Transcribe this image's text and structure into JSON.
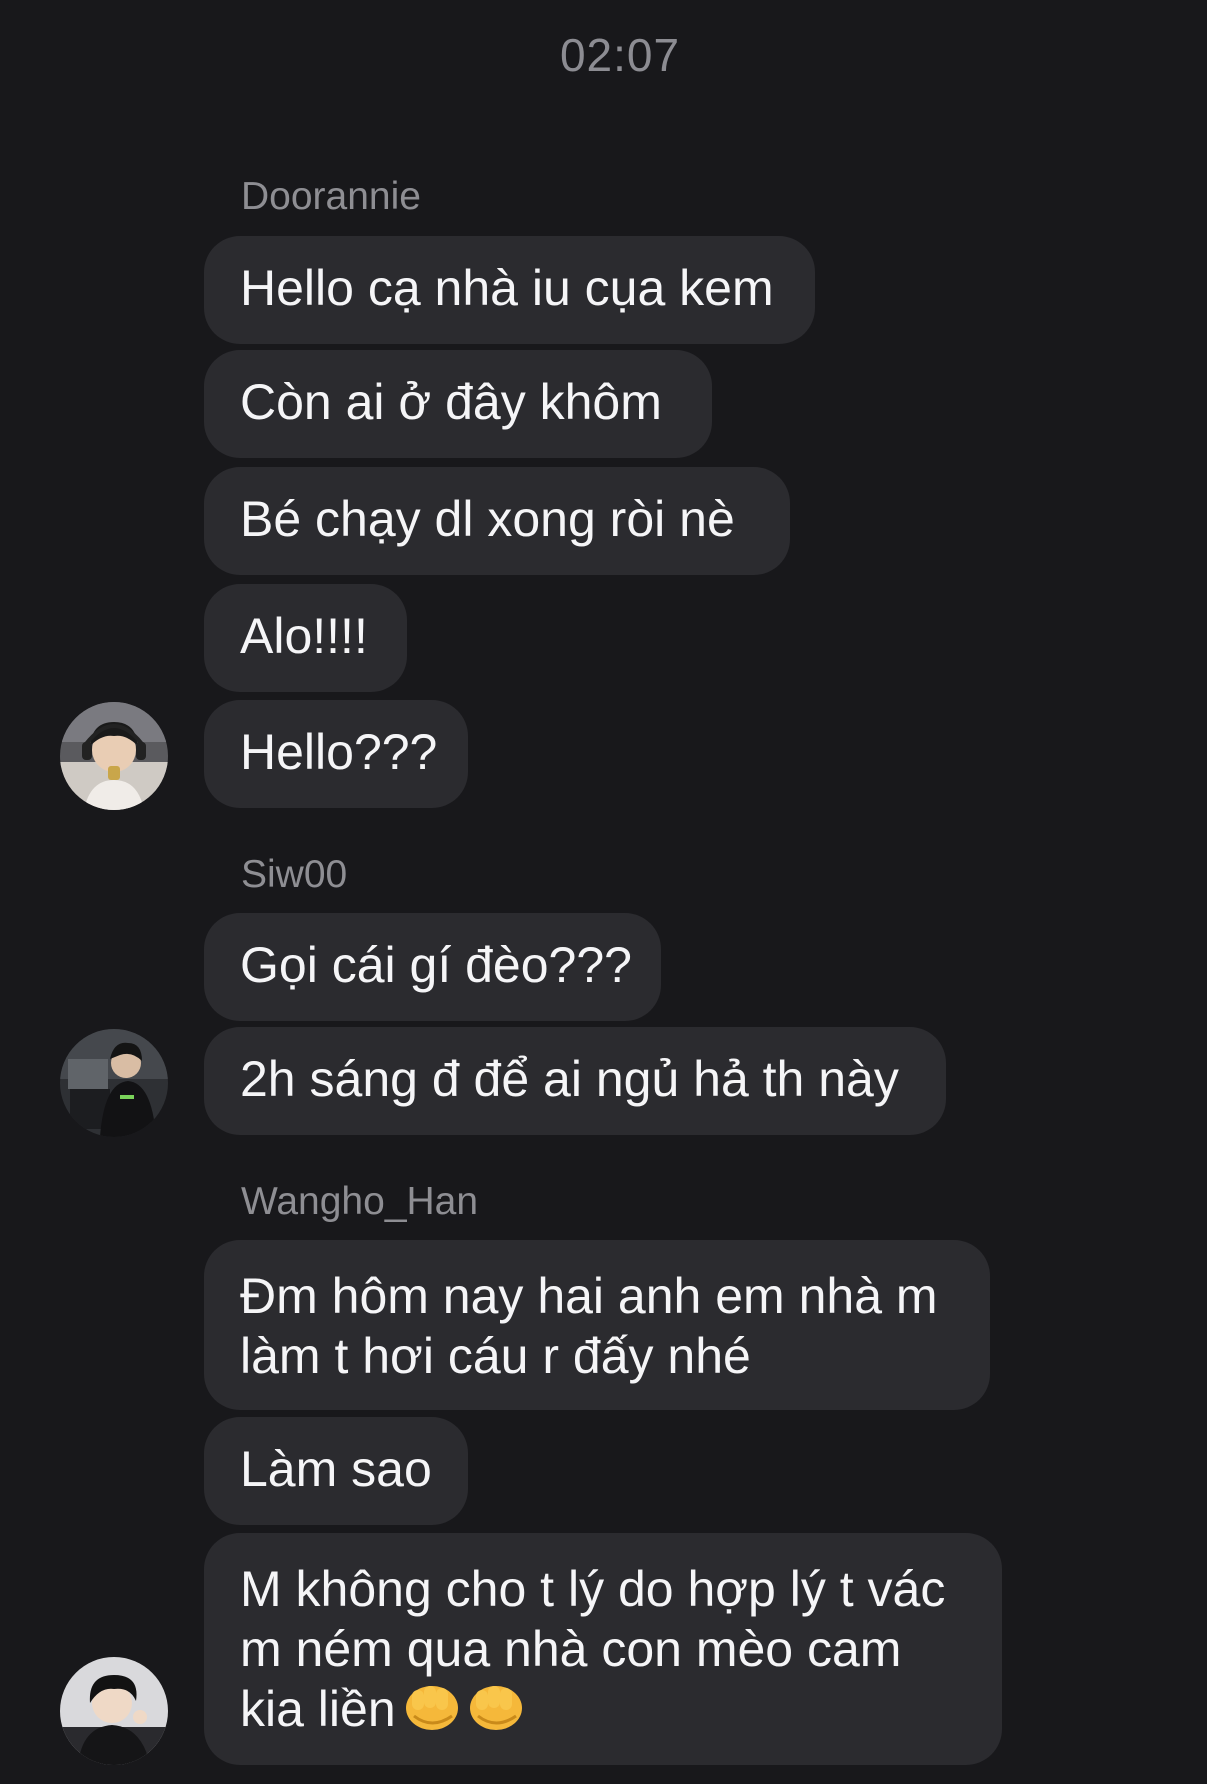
{
  "timestamp": "02:07",
  "groups": [
    {
      "sender": "Doorannie",
      "messages": [
        "Hello cạ nhà iu cụa kem",
        "Còn ai ở đây khôm",
        "Bé chạy dl xong ròi nè",
        "Alo!!!!",
        "Hello???"
      ],
      "avatar_icon": "user-avatar-photo"
    },
    {
      "sender": "Siw00",
      "messages": [
        "Gọi cái gí đèo???",
        "2h sáng đ để ai ngủ hả th này"
      ],
      "avatar_icon": "user-avatar-photo"
    },
    {
      "sender": "Wangho_Han",
      "messages": [
        "Đm hôm nay hai anh em nhà m làm t hơi cáu r đấy nhé",
        "Làm sao",
        "M không cho t lý do hợp lý t vác m ném qua nhà con mèo cam kia liền"
      ],
      "trailing_emoji": "👊👊",
      "avatar_icon": "user-avatar-photo"
    }
  ],
  "colors": {
    "background": "#18181b",
    "bubble": "#2b2b2f",
    "text": "#f5f5f7",
    "muted": "#8e8e93"
  }
}
